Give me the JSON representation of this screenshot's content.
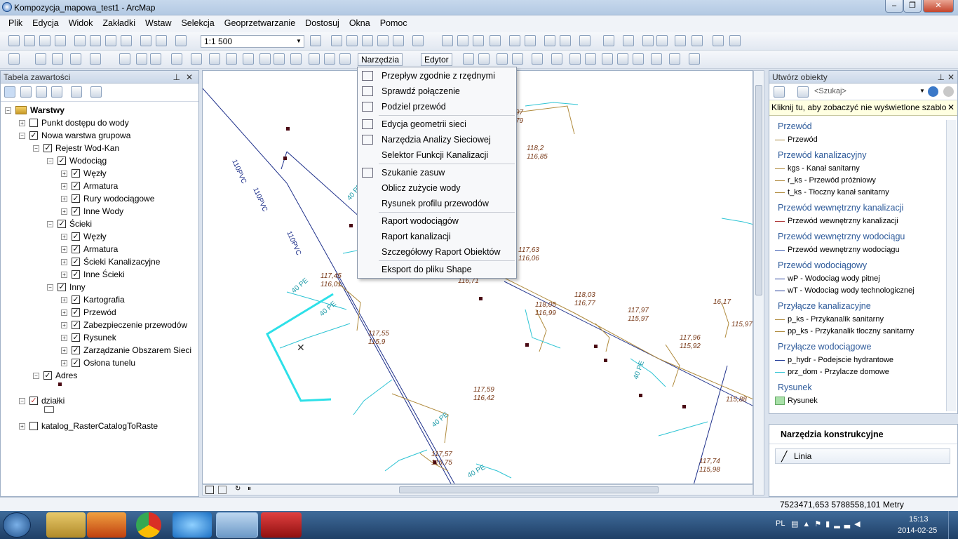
{
  "window": {
    "title": "Kompozycja_mapowa_test1 - ArcMap",
    "min": "–",
    "max": "❐",
    "close": "✕"
  },
  "menu": [
    "Plik",
    "Edycja",
    "Widok",
    "Zakładki",
    "Wstaw",
    "Selekcja",
    "Geoprzetwarzanie",
    "Dostosuj",
    "Okna",
    "Pomoc"
  ],
  "toolbar": {
    "scale": "1:1 500",
    "narzedzia": "Narzędzia",
    "edytor": "Edytor"
  },
  "toc": {
    "title": "Tabela zawartości",
    "items": [
      {
        "label": "Warstwy",
        "bold": true
      },
      {
        "label": "Punkt dostępu do wody"
      },
      {
        "label": "Nowa warstwa grupowa"
      },
      {
        "label": "Rejestr Wod-Kan"
      },
      {
        "label": "Wodociąg"
      },
      {
        "label": "Węzły"
      },
      {
        "label": "Armatura"
      },
      {
        "label": "Rury wodociągowe"
      },
      {
        "label": "Inne Wody"
      },
      {
        "label": "Ścieki"
      },
      {
        "label": "Węzły"
      },
      {
        "label": "Armatura"
      },
      {
        "label": "Ścieki Kanalizacyjne"
      },
      {
        "label": "Inne Ścieki"
      },
      {
        "label": "Inny"
      },
      {
        "label": "Kartografia"
      },
      {
        "label": "Przewód"
      },
      {
        "label": "Zabezpieczenie przewodów"
      },
      {
        "label": "Rysunek"
      },
      {
        "label": "Zarządzanie Obszarem Sieci"
      },
      {
        "label": "Osłona tunelu"
      },
      {
        "label": "Adres"
      },
      {
        "label": "działki"
      },
      {
        "label": "katalog_RasterCatalogToRaste"
      }
    ]
  },
  "tools_menu": [
    "Przepływ zgodnie z rzędnymi",
    "Sprawdź połączenie",
    "Podziel przewód",
    "Edycja geometrii sieci",
    "Narzędzia Analizy Sieciowej",
    "Selektor Funkcji Kanalizacji",
    "Szukanie zasuw",
    "Oblicz zużycie wody",
    "Rysunek profilu przewodów",
    "Raport wodociągów",
    "Raport kanalizacji",
    "Szczegółowy Raport Obiektów",
    "Eksport do pliku Shape"
  ],
  "map_labels": [
    "110PVC",
    "110PVC",
    "110PVC",
    "117,45",
    "116,01",
    "117,55",
    "115,9",
    "117,59",
    "116,42",
    "117,57",
    "115,75",
    "117,63",
    "116,06",
    "116,71",
    "118,03",
    "116,77",
    "118,05",
    "116,99",
    "117,97",
    "115,97",
    "117,96",
    "115,92",
    "118,2",
    "116,85",
    "16,17",
    "115,97",
    "117,74",
    "115,98",
    "115,88",
    "40 PE",
    "40 PE",
    "40 PE",
    "40 PE",
    "40 PE",
    "40 PE",
    "97",
    "79"
  ],
  "create_pane": {
    "title": "Utwórz obiekty",
    "search_placeholder": "<Szukaj>",
    "notice": "Kliknij tu, aby zobaczyć nie wyświetlone szablo",
    "groups": [
      {
        "name": "Przewód",
        "items": [
          {
            "label": "Przewód",
            "color": "#a8873a"
          }
        ]
      },
      {
        "name": "Przewód kanalizacyjny",
        "items": [
          {
            "label": "kgs - Kanał sanitarny",
            "color": "#b08a3c"
          },
          {
            "label": "r_ks - Przewód próżniowy",
            "color": "#b08a3c"
          },
          {
            "label": "t_ks - Tłoczny kanał sanitarny",
            "color": "#b08a3c"
          }
        ]
      },
      {
        "name": "Przewód wewnętrzny kanalizacji",
        "items": [
          {
            "label": "Przewód wewnętrzny kanalizacji",
            "color": "#b03a3a"
          }
        ]
      },
      {
        "name": "Przewód wewnętrzny wodociągu",
        "items": [
          {
            "label": "Przewód wewnętrzny wodociągu",
            "color": "#3a5ab0"
          }
        ]
      },
      {
        "name": "Przewód wodociągowy",
        "items": [
          {
            "label": "wP - Wodociag wody pitnej",
            "color": "#243e9a"
          },
          {
            "label": "wT - Wodociag wody technologicznej",
            "color": "#243e9a"
          }
        ]
      },
      {
        "name": "Przyłącze kanalizacyjne",
        "items": [
          {
            "label": "p_ks - Przykanalik sanitarny",
            "color": "#b08a3c"
          },
          {
            "label": "pp_ks - Przykanalik tłoczny sanitarny",
            "color": "#b08a3c"
          }
        ]
      },
      {
        "name": "Przyłącze wodociągowe",
        "items": [
          {
            "label": "p_hydr - Podejscie hydrantowe",
            "color": "#243e9a"
          },
          {
            "label": "prz_dom - Przylacze domowe",
            "color": "#2ec4d4"
          }
        ]
      },
      {
        "name": "Rysunek",
        "items": [
          {
            "label": "Rysunek",
            "color": "#a8e0a8"
          }
        ]
      }
    ]
  },
  "construct_pane": {
    "title": "Narzędzia konstrukcyjne",
    "tool": "Linia"
  },
  "status": {
    "coords": "7523471,653  5788558,101 Metry"
  },
  "taskbar": {
    "lang": "PL",
    "time": "15:13",
    "date": "2014-02-25"
  }
}
